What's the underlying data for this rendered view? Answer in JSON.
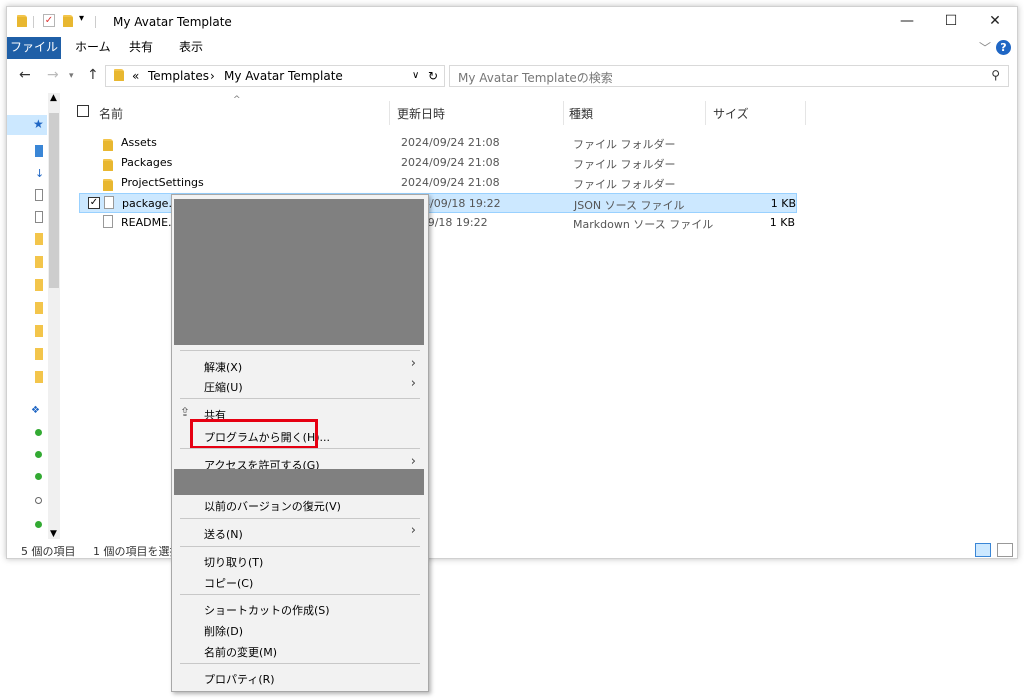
{
  "window": {
    "title": "My Avatar Template",
    "controls": [
      "—",
      "☐",
      "✕"
    ]
  },
  "ribbon": {
    "tabs": [
      "ファイル",
      "ホーム",
      "共有",
      "表示"
    ],
    "help": "?"
  },
  "address": {
    "overflow": "«",
    "crumbs": [
      "Templates",
      "My Avatar Template"
    ],
    "separator": "›"
  },
  "search": {
    "placeholder": "My Avatar Templateの検索"
  },
  "columns": {
    "name": "名前",
    "modified": "更新日時",
    "type": "種類",
    "size": "サイズ"
  },
  "files": [
    {
      "name": "Assets",
      "modified": "2024/09/24 21:08",
      "type": "ファイル フォルダー",
      "size": "",
      "icon": "folder-icon"
    },
    {
      "name": "Packages",
      "modified": "2024/09/24 21:08",
      "type": "ファイル フォルダー",
      "size": "",
      "icon": "folder-icon"
    },
    {
      "name": "ProjectSettings",
      "modified": "2024/09/24 21:08",
      "type": "ファイル フォルダー",
      "size": "",
      "icon": "folder-icon"
    },
    {
      "name": "package.jso",
      "modified": "2024/09/18 19:22",
      "type": "JSON ソース ファイル",
      "size": "1 KB",
      "icon": "json-file-icon",
      "selected": true
    },
    {
      "name": "README.m",
      "modified": "/09/18 19:22",
      "type": "Markdown ソース ファイル",
      "size": "1 KB",
      "icon": "markdown-file-icon"
    }
  ],
  "status": {
    "count": "5 個の項目",
    "selected": "1 個の項目を選択"
  },
  "context_menu": {
    "extract": "解凍(X)",
    "compress": "圧縮(U)",
    "share": "共有",
    "open_with": "プログラムから開く(H)...",
    "give_access": "アクセスを許可する(G)",
    "restore": "以前のバージョンの復元(V)",
    "send_to": "送る(N)",
    "cut": "切り取り(T)",
    "copy": "コピー(C)",
    "shortcut": "ショートカットの作成(S)",
    "delete": "削除(D)",
    "rename": "名前の変更(M)",
    "properties": "プロパティ(R)"
  },
  "colors": {
    "file_tab": "#1f5fa7",
    "selection": "#cce8ff",
    "highlight_box": "#e60012",
    "redaction": "#808080"
  }
}
